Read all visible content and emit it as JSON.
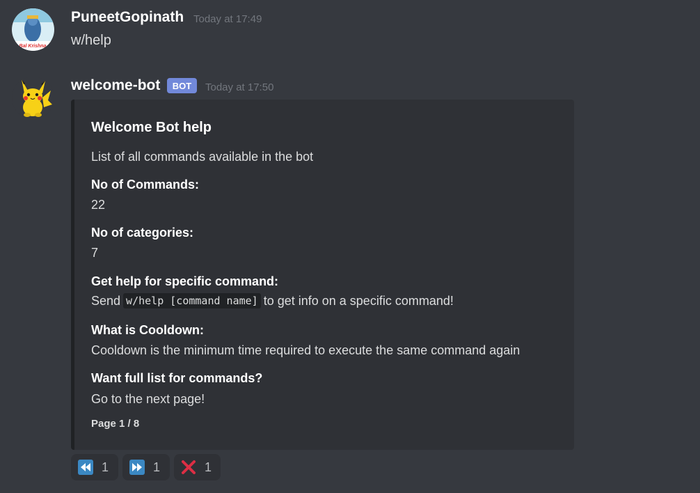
{
  "messages": [
    {
      "username": "PuneetGopinath",
      "timestamp": "Today at 17:49",
      "content": "w/help",
      "avatar_text": "Bal Krishna"
    },
    {
      "username": "welcome-bot",
      "badge": "BOT",
      "timestamp": "Today at 17:50",
      "avatar_icon": "pikachu-icon"
    }
  ],
  "embed": {
    "title": "Welcome Bot help",
    "description": "List of all commands available in the bot",
    "fields": [
      {
        "name": "No of Commands:",
        "value": "22"
      },
      {
        "name": "No of categories:",
        "value": "7"
      },
      {
        "name": "Get help for specific command:",
        "value_prefix": "Send",
        "value_code": "w/help [command name]",
        "value_suffix": "to get info on a specific command!"
      },
      {
        "name": "What is Cooldown:",
        "value": "Cooldown is the minimum time required to execute the same command again"
      },
      {
        "name": "Want full list for commands?",
        "value": "Go to the next page!"
      }
    ],
    "footer": "Page 1 / 8"
  },
  "reactions": [
    {
      "icon": "rewind-icon",
      "count": "1"
    },
    {
      "icon": "fast-forward-icon",
      "count": "1"
    },
    {
      "icon": "cross-mark-icon",
      "count": "1"
    }
  ],
  "colors": {
    "background": "#36393f",
    "embed_background": "#2f3136",
    "bot_badge": "#7289da",
    "reaction_blue": "#3b88c3",
    "cross_red": "#dd2e44"
  }
}
